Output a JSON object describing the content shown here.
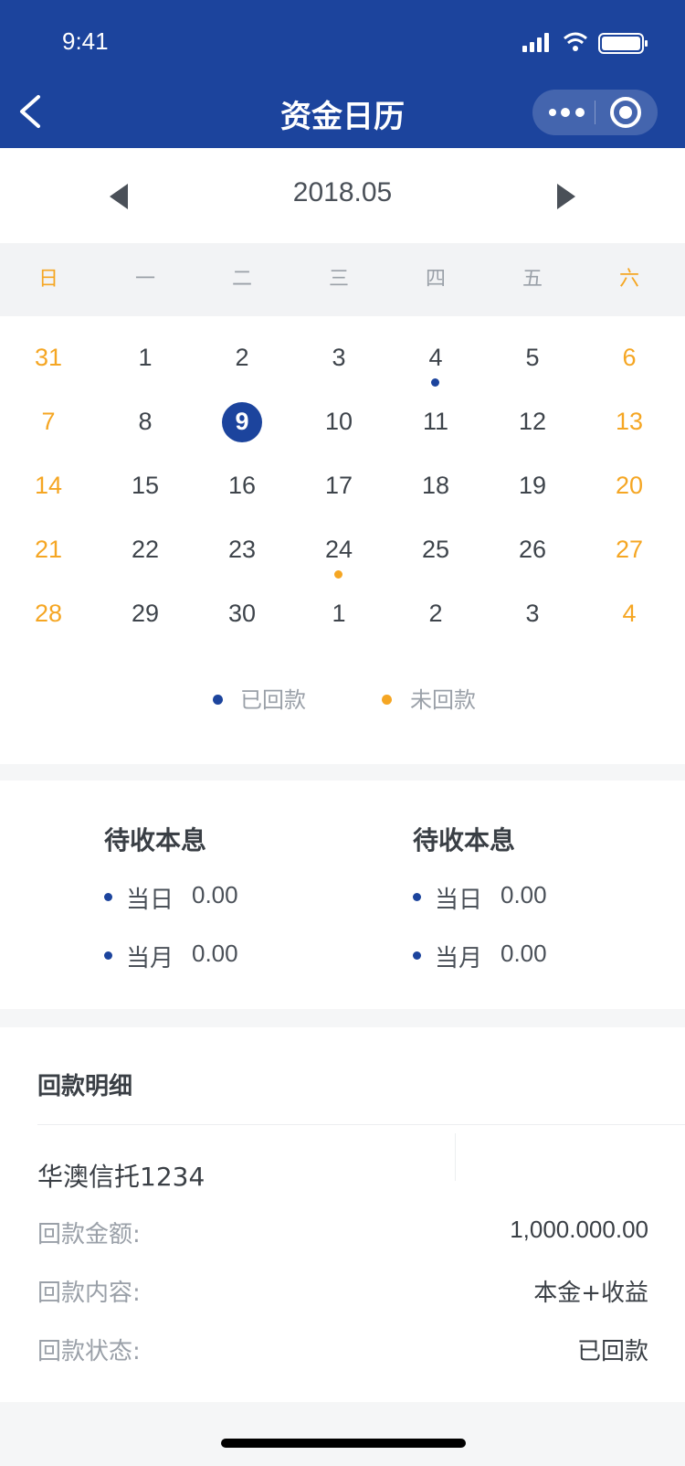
{
  "status_bar": {
    "time": "9:41"
  },
  "nav": {
    "title": "资金日历"
  },
  "month_bar": {
    "month": "2018.05"
  },
  "weekdays": [
    "日",
    "一",
    "二",
    "三",
    "四",
    "五",
    "六"
  ],
  "calendar": {
    "weeks": [
      [
        "31",
        "1",
        "2",
        "3",
        "4",
        "5",
        "6"
      ],
      [
        "7",
        "8",
        "9",
        "10",
        "11",
        "12",
        "13"
      ],
      [
        "14",
        "15",
        "16",
        "17",
        "18",
        "19",
        "20"
      ],
      [
        "21",
        "22",
        "23",
        "24",
        "25",
        "26",
        "27"
      ],
      [
        "28",
        "29",
        "30",
        "1",
        "2",
        "3",
        "4"
      ]
    ],
    "selected_day": "9",
    "paid_days": [
      "4"
    ],
    "unpaid_days": [
      "24"
    ]
  },
  "legend": {
    "paid": "已回款",
    "unpaid": "未回款"
  },
  "summary": [
    {
      "title": "待收本息",
      "day_label": "当日",
      "day_value": "0.00",
      "month_label": "当月",
      "month_value": "0.00"
    },
    {
      "title": "待收本息",
      "day_label": "当日",
      "day_value": "0.00",
      "month_label": "当月",
      "month_value": "0.00"
    }
  ],
  "detail": {
    "title": "回款明细",
    "product": "华澳信托1234",
    "rows": [
      {
        "label": "回款金额:",
        "value": "1,000.000.00"
      },
      {
        "label": "回款内容:",
        "value": "本金+收益"
      },
      {
        "label": "回款状态:",
        "value": "已回款"
      }
    ]
  },
  "colors": {
    "brand": "#1c449d",
    "weekend": "#f5a623",
    "muted": "#9aa0a8"
  }
}
